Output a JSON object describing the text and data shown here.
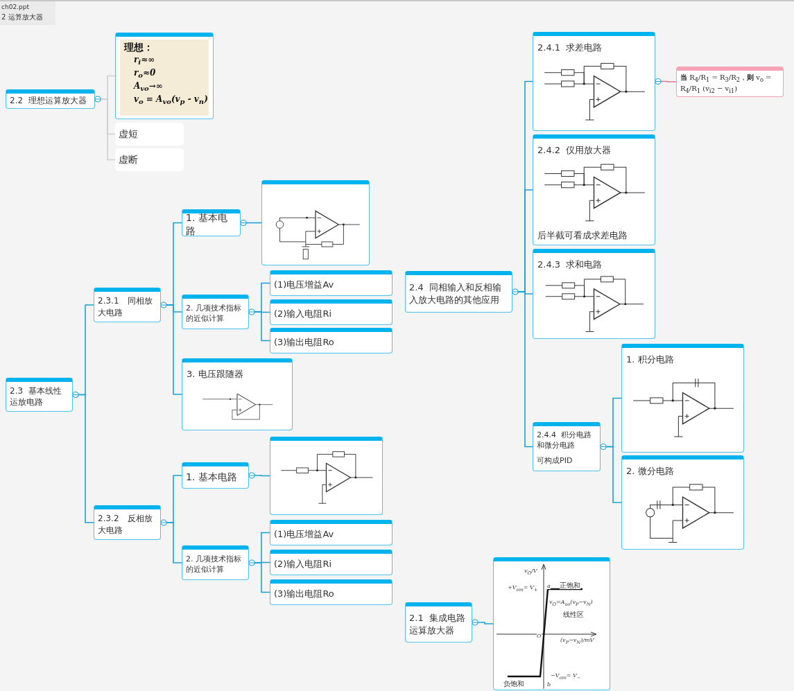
{
  "file_tab": {
    "file": "ch02.ppt",
    "sheet": "2 运算放大器"
  },
  "topics": [
    {
      "kind": "topic",
      "title": "2.2  理想运算放大器",
      "children": [
        {
          "kind": "formula",
          "lines": [
            "理想：",
            "r$_{i}$≈∞",
            "r$_{o}$≈0",
            "A$_{vo}$→∞",
            "v$_{o}$ = A$_{vo}$(v$_{p}$ - v$_{n}$)"
          ]
        },
        {
          "kind": "plain",
          "title": "虚短"
        },
        {
          "kind": "plain",
          "title": "虚断"
        }
      ]
    },
    {
      "kind": "topic",
      "title": "2.3  基本线性运放电路",
      "children": [
        {
          "kind": "topic",
          "title": "2.3.1　同相放大电路",
          "children": [
            {
              "kind": "topic",
              "title": "1. 基本电路",
              "children": [
                {
                  "kind": "circuit"
                }
              ]
            },
            {
              "kind": "topic",
              "title": "2. 几项技术指标的近似计算",
              "children": [
                {
                  "kind": "topic",
                  "title": "(1)电压增益Av"
                },
                {
                  "kind": "topic",
                  "title": "(2)输入电阻Ri"
                },
                {
                  "kind": "topic",
                  "title": "(3)输出电阻Ro"
                }
              ]
            },
            {
              "kind": "circuit",
              "title": "3. 电压跟随器"
            }
          ]
        },
        {
          "kind": "topic",
          "title": "2.3.2　反相放大电路",
          "children": [
            {
              "kind": "topic",
              "title": "1. 基本电路",
              "children": [
                {
                  "kind": "circuit"
                }
              ]
            },
            {
              "kind": "topic",
              "title": "2. 几项技术指标的近似计算",
              "children": [
                {
                  "kind": "topic",
                  "title": "(1)电压增益Av"
                },
                {
                  "kind": "topic",
                  "title": "(2)输入电阻Ri"
                },
                {
                  "kind": "topic",
                  "title": "(3)输出电阻Ro"
                }
              ]
            }
          ]
        }
      ]
    },
    {
      "kind": "topic",
      "title": "2.4  同相输入和反相输入放大电路的其他应用",
      "children": [
        {
          "kind": "circuit",
          "title": "2.4.1  求差电路",
          "children": [
            {
              "kind": "note",
              "text": "**当** R$_{4}$/R$_{1}$ = R$_{3}$/R$_{2}$，**则** v$_{o}$ = R$_{4}$/R$_{1}$ (v$_{i2}$ − v$_{i1}$)"
            }
          ]
        },
        {
          "kind": "circuit",
          "title": "2.4.2  仪用放大器",
          "caption": "后半截可看成求差电路"
        },
        {
          "kind": "circuit",
          "title": "2.4.3  求和电路"
        },
        {
          "kind": "topic",
          "title": "2.4.4  积分电路和微分电路",
          "subtitle": "可构成PID",
          "children": [
            {
              "kind": "circuit",
              "title": "1. 积分电路"
            },
            {
              "kind": "circuit",
              "title": "2. 微分电路"
            }
          ]
        }
      ]
    },
    {
      "kind": "topic",
      "title": "2.1  集成电路运算放大器",
      "children": [
        {
          "kind": "transfer",
          "labels": [
            "v$_{O}$/V",
            "+V$_{om}$= V$_{+}$",
            "a",
            "正饱和",
            "v$_{O}$=A$_{vo}$(v$_{P}$−v$_{N}$)",
            "线性区",
            "O",
            "(v$_{P}$−v$_{N}$)/mV",
            "−V$_{om}$= V$_{−}$",
            "负饱和",
            "b"
          ]
        }
      ]
    }
  ]
}
